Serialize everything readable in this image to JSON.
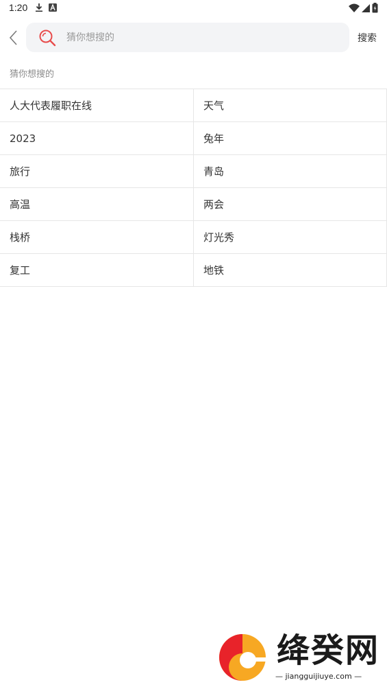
{
  "status_bar": {
    "time": "1:20",
    "icons": [
      "download-icon",
      "a-notification-icon",
      "wifi-icon",
      "signal-icon",
      "battery-icon"
    ]
  },
  "search": {
    "placeholder": "猜你想搜的",
    "button_label": "搜索",
    "accent_color": "#e84b4b"
  },
  "section": {
    "title": "猜你想搜的"
  },
  "suggestions": [
    [
      "人大代表履职在线",
      "天气"
    ],
    [
      "2023",
      "兔年"
    ],
    [
      "旅行",
      "青岛"
    ],
    [
      "高温",
      "两会"
    ],
    [
      "栈桥",
      "灯光秀"
    ],
    [
      "复工",
      "地铁"
    ]
  ],
  "watermark": {
    "name": "绛癸网",
    "url": "jiangguijiuye.com",
    "colors": [
      "#e8232a",
      "#f7a823"
    ]
  }
}
